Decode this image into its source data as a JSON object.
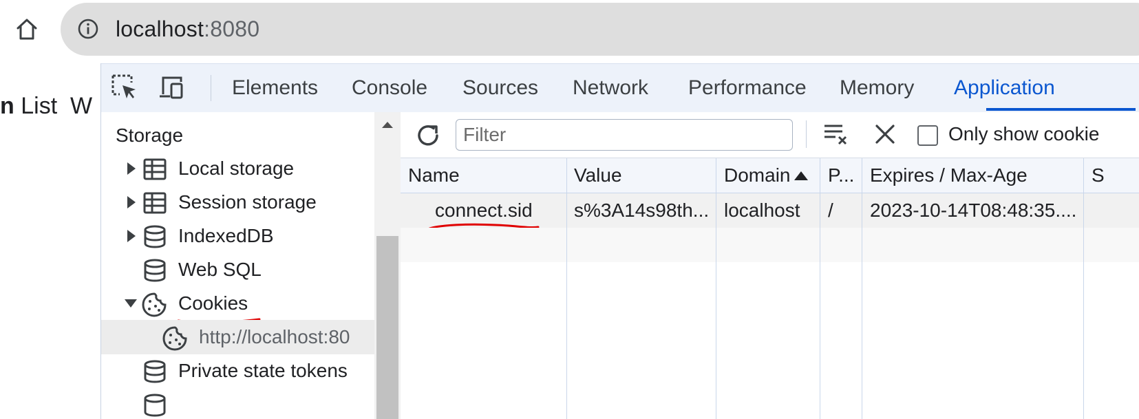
{
  "browser": {
    "url_host": "localhost",
    "url_port": ":8080"
  },
  "page": {
    "bold_char": "n",
    "text_after": " List  W"
  },
  "devtools": {
    "tabs": [
      {
        "label": "Elements"
      },
      {
        "label": "Console"
      },
      {
        "label": "Sources"
      },
      {
        "label": "Network"
      },
      {
        "label": "Performance"
      },
      {
        "label": "Memory"
      },
      {
        "label": "Application",
        "active": true
      }
    ],
    "sidebar": {
      "section_title": "Storage",
      "items": [
        {
          "label": "Local storage",
          "icon": "table-icon",
          "expanded": false
        },
        {
          "label": "Session storage",
          "icon": "table-icon",
          "expanded": false
        },
        {
          "label": "IndexedDB",
          "icon": "database-icon",
          "expanded": false
        },
        {
          "label": "Web SQL",
          "icon": "database-icon"
        },
        {
          "label": "Cookies",
          "icon": "cookie-icon",
          "expanded": true
        },
        {
          "label": "http://localhost:80",
          "icon": "cookie-icon",
          "selected": true
        },
        {
          "label": "Private state tokens",
          "icon": "database-icon"
        }
      ]
    },
    "toolbar": {
      "filter_placeholder": "Filter",
      "only_show_label": "Only show cookie"
    },
    "table": {
      "columns": [
        "Name",
        "Value",
        "Domain",
        "P...",
        "Expires / Max-Age",
        "S"
      ],
      "sort_column": "Domain",
      "rows": [
        {
          "name": "connect.sid",
          "value": "s%3A14s98th...",
          "domain": "localhost",
          "path": "/",
          "expires": "2023-10-14T08:48:35...."
        }
      ]
    },
    "annotation_color": "#e00000",
    "accent_color": "#0b57d0"
  }
}
